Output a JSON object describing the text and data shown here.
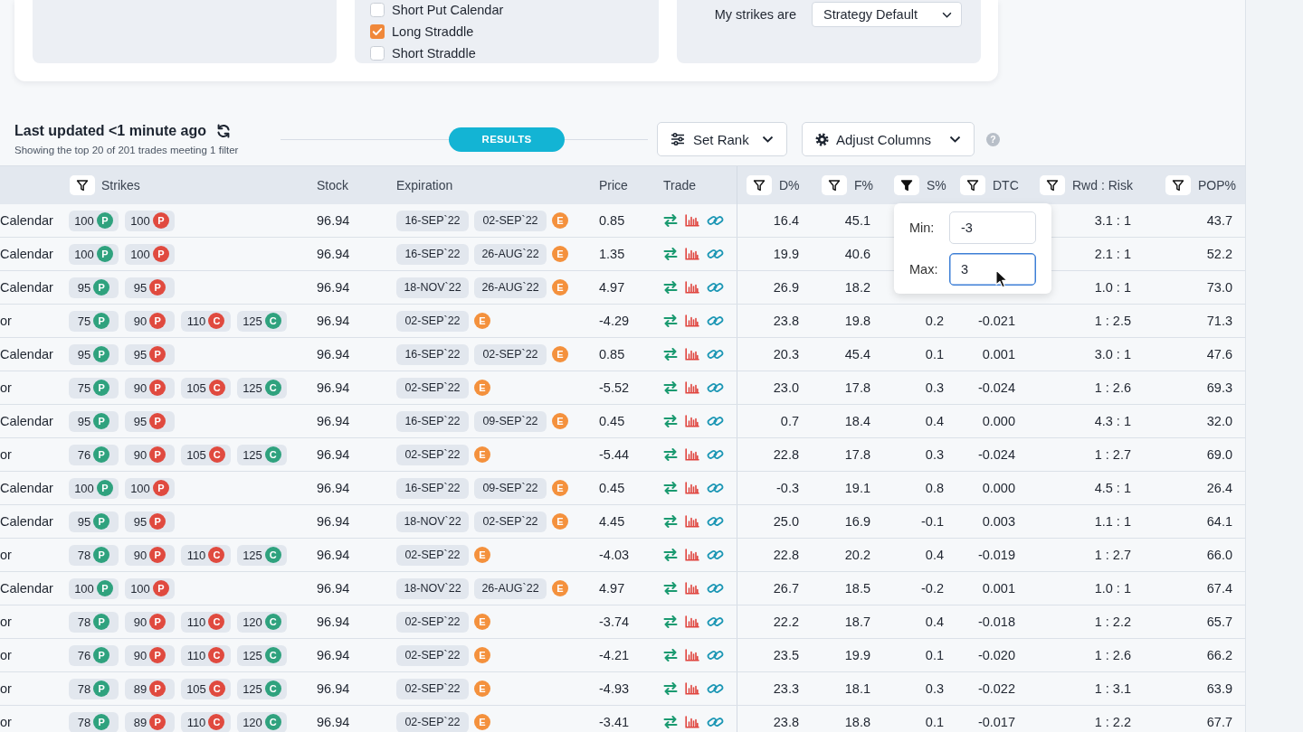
{
  "strategy_panel": {
    "checkboxes": [
      {
        "label": "Short Put Calendar",
        "checked": false
      },
      {
        "label": "Long Straddle",
        "checked": true
      },
      {
        "label": "Short Straddle",
        "checked": false
      }
    ]
  },
  "strikes_panel": {
    "label": "My strikes are",
    "select": {
      "value": "Strategy Default"
    }
  },
  "results_header": {
    "title": "Last updated <1 minute ago",
    "subtitle": "Showing the top 20 of 201 trades meeting 1 filter",
    "section_label": "RESULTS",
    "buttons": [
      {
        "label": "Set Rank",
        "kind": "rank"
      },
      {
        "label": "Adjust Columns",
        "kind": "columns"
      }
    ],
    "help": "?"
  },
  "table": {
    "columns": [
      {
        "label": "Strikes",
        "filter_active": false
      },
      {
        "label": "Stock"
      },
      {
        "label": "Expiration"
      },
      {
        "label": "Price"
      },
      {
        "label": "Trade"
      },
      {
        "label": "D%",
        "filter_active": false
      },
      {
        "label": "F%",
        "filter_active": false
      },
      {
        "label": "S%",
        "filter_active": true,
        "popup": {
          "fields": [
            {
              "label": "Min:",
              "value": "-3",
              "focused": false
            },
            {
              "label": "Max:",
              "value": "3",
              "focused": true
            }
          ]
        }
      },
      {
        "label": "DTC",
        "filter_active": false
      },
      {
        "label": "Rwd : Risk",
        "filter_active": false
      },
      {
        "label": "POP%",
        "filter_active": false
      }
    ],
    "rows": [
      {
        "column_1": "Calendar",
        "strikes": [
          {
            "value": "100",
            "type": "P",
            "color": "#2fa27e"
          },
          {
            "value": "100",
            "type": "P",
            "color": "#e04a3f"
          }
        ],
        "stock": "96.94",
        "expiration": {
          "dates": [
            "16-SEP`22",
            "02-SEP`22"
          ],
          "badge": "E"
        },
        "price": "0.85",
        "d_pct": "16.4",
        "f_pct": "45.1",
        "rwd_risk": "3.1 : 1",
        "pop_pct": "43.7"
      },
      {
        "column_1": "Calendar",
        "strikes": [
          {
            "value": "100",
            "type": "P",
            "color": "#2fa27e"
          },
          {
            "value": "100",
            "type": "P",
            "color": "#e04a3f"
          }
        ],
        "stock": "96.94",
        "expiration": {
          "dates": [
            "16-SEP`22",
            "26-AUG`22"
          ],
          "badge": "E"
        },
        "price": "1.35",
        "d_pct": "19.9",
        "f_pct": "40.6",
        "rwd_risk": "2.1 : 1",
        "pop_pct": "52.2"
      },
      {
        "column_1": "Calendar",
        "strikes": [
          {
            "value": "95",
            "type": "P",
            "color": "#2fa27e"
          },
          {
            "value": "95",
            "type": "P",
            "color": "#e04a3f"
          }
        ],
        "stock": "96.94",
        "expiration": {
          "dates": [
            "18-NOV`22",
            "26-AUG`22"
          ],
          "badge": "E"
        },
        "price": "4.97",
        "d_pct": "26.9",
        "f_pct": "18.2",
        "rwd_risk": "1.0 : 1",
        "pop_pct": "73.0"
      },
      {
        "column_1": "or",
        "strikes": [
          {
            "value": "75",
            "type": "P",
            "color": "#2fa27e"
          },
          {
            "value": "90",
            "type": "P",
            "color": "#e04a3f"
          },
          {
            "value": "110",
            "type": "C",
            "color": "#e04a3f"
          },
          {
            "value": "125",
            "type": "C",
            "color": "#2fa27e"
          }
        ],
        "stock": "96.94",
        "expiration": {
          "dates": [
            "02-SEP`22"
          ],
          "badge": "E"
        },
        "price": "-4.29",
        "d_pct": "23.8",
        "f_pct": "19.8",
        "s_pct": "0.2",
        "dtc": "-0.021",
        "rwd_risk": "1 : 2.5",
        "pop_pct": "71.3"
      },
      {
        "column_1": "Calendar",
        "strikes": [
          {
            "value": "95",
            "type": "P",
            "color": "#2fa27e"
          },
          {
            "value": "95",
            "type": "P",
            "color": "#e04a3f"
          }
        ],
        "stock": "96.94",
        "expiration": {
          "dates": [
            "16-SEP`22",
            "02-SEP`22"
          ],
          "badge": "E"
        },
        "price": "0.85",
        "d_pct": "20.3",
        "f_pct": "45.4",
        "s_pct": "0.1",
        "dtc": "0.001",
        "rwd_risk": "3.0 : 1",
        "pop_pct": "47.6"
      },
      {
        "column_1": "or",
        "strikes": [
          {
            "value": "75",
            "type": "P",
            "color": "#2fa27e"
          },
          {
            "value": "90",
            "type": "P",
            "color": "#e04a3f"
          },
          {
            "value": "105",
            "type": "C",
            "color": "#e04a3f"
          },
          {
            "value": "125",
            "type": "C",
            "color": "#2fa27e"
          }
        ],
        "stock": "96.94",
        "expiration": {
          "dates": [
            "02-SEP`22"
          ],
          "badge": "E"
        },
        "price": "-5.52",
        "d_pct": "23.0",
        "f_pct": "17.8",
        "s_pct": "0.3",
        "dtc": "-0.024",
        "rwd_risk": "1 : 2.6",
        "pop_pct": "69.3"
      },
      {
        "column_1": "Calendar",
        "strikes": [
          {
            "value": "95",
            "type": "P",
            "color": "#2fa27e"
          },
          {
            "value": "95",
            "type": "P",
            "color": "#e04a3f"
          }
        ],
        "stock": "96.94",
        "expiration": {
          "dates": [
            "16-SEP`22",
            "09-SEP`22"
          ],
          "badge": "E"
        },
        "price": "0.45",
        "d_pct": "0.7",
        "f_pct": "18.4",
        "s_pct": "0.4",
        "dtc": "0.000",
        "rwd_risk": "4.3 : 1",
        "pop_pct": "32.0"
      },
      {
        "column_1": "or",
        "strikes": [
          {
            "value": "76",
            "type": "P",
            "color": "#2fa27e"
          },
          {
            "value": "90",
            "type": "P",
            "color": "#e04a3f"
          },
          {
            "value": "105",
            "type": "C",
            "color": "#e04a3f"
          },
          {
            "value": "125",
            "type": "C",
            "color": "#2fa27e"
          }
        ],
        "stock": "96.94",
        "expiration": {
          "dates": [
            "02-SEP`22"
          ],
          "badge": "E"
        },
        "price": "-5.44",
        "d_pct": "22.8",
        "f_pct": "17.8",
        "s_pct": "0.3",
        "dtc": "-0.024",
        "rwd_risk": "1 : 2.7",
        "pop_pct": "69.0"
      },
      {
        "column_1": "Calendar",
        "strikes": [
          {
            "value": "100",
            "type": "P",
            "color": "#2fa27e"
          },
          {
            "value": "100",
            "type": "P",
            "color": "#e04a3f"
          }
        ],
        "stock": "96.94",
        "expiration": {
          "dates": [
            "16-SEP`22",
            "09-SEP`22"
          ],
          "badge": "E"
        },
        "price": "0.45",
        "d_pct": "-0.3",
        "f_pct": "19.1",
        "s_pct": "0.8",
        "dtc": "0.000",
        "rwd_risk": "4.5 : 1",
        "pop_pct": "26.4"
      },
      {
        "column_1": "Calendar",
        "strikes": [
          {
            "value": "95",
            "type": "P",
            "color": "#2fa27e"
          },
          {
            "value": "95",
            "type": "P",
            "color": "#e04a3f"
          }
        ],
        "stock": "96.94",
        "expiration": {
          "dates": [
            "18-NOV`22",
            "02-SEP`22"
          ],
          "badge": "E"
        },
        "price": "4.45",
        "d_pct": "25.0",
        "f_pct": "16.9",
        "s_pct": "-0.1",
        "dtc": "0.003",
        "rwd_risk": "1.1 : 1",
        "pop_pct": "64.1"
      },
      {
        "column_1": "or",
        "strikes": [
          {
            "value": "78",
            "type": "P",
            "color": "#2fa27e"
          },
          {
            "value": "90",
            "type": "P",
            "color": "#e04a3f"
          },
          {
            "value": "110",
            "type": "C",
            "color": "#e04a3f"
          },
          {
            "value": "125",
            "type": "C",
            "color": "#2fa27e"
          }
        ],
        "stock": "96.94",
        "expiration": {
          "dates": [
            "02-SEP`22"
          ],
          "badge": "E"
        },
        "price": "-4.03",
        "d_pct": "22.8",
        "f_pct": "20.2",
        "s_pct": "0.4",
        "dtc": "-0.019",
        "rwd_risk": "1 : 2.7",
        "pop_pct": "66.0"
      },
      {
        "column_1": "Calendar",
        "strikes": [
          {
            "value": "100",
            "type": "P",
            "color": "#2fa27e"
          },
          {
            "value": "100",
            "type": "P",
            "color": "#e04a3f"
          }
        ],
        "stock": "96.94",
        "expiration": {
          "dates": [
            "18-NOV`22",
            "26-AUG`22"
          ],
          "badge": "E"
        },
        "price": "4.97",
        "d_pct": "26.7",
        "f_pct": "18.5",
        "s_pct": "-0.2",
        "dtc": "0.001",
        "rwd_risk": "1.0 : 1",
        "pop_pct": "67.4"
      },
      {
        "column_1": "or",
        "strikes": [
          {
            "value": "78",
            "type": "P",
            "color": "#2fa27e"
          },
          {
            "value": "90",
            "type": "P",
            "color": "#e04a3f"
          },
          {
            "value": "110",
            "type": "C",
            "color": "#e04a3f"
          },
          {
            "value": "120",
            "type": "C",
            "color": "#2fa27e"
          }
        ],
        "stock": "96.94",
        "expiration": {
          "dates": [
            "02-SEP`22"
          ],
          "badge": "E"
        },
        "price": "-3.74",
        "d_pct": "22.2",
        "f_pct": "18.7",
        "s_pct": "0.4",
        "dtc": "-0.018",
        "rwd_risk": "1 : 2.2",
        "pop_pct": "65.7"
      },
      {
        "column_1": "or",
        "strikes": [
          {
            "value": "76",
            "type": "P",
            "color": "#2fa27e"
          },
          {
            "value": "90",
            "type": "P",
            "color": "#e04a3f"
          },
          {
            "value": "110",
            "type": "C",
            "color": "#e04a3f"
          },
          {
            "value": "125",
            "type": "C",
            "color": "#2fa27e"
          }
        ],
        "stock": "96.94",
        "expiration": {
          "dates": [
            "02-SEP`22"
          ],
          "badge": "E"
        },
        "price": "-4.21",
        "d_pct": "23.5",
        "f_pct": "19.9",
        "s_pct": "0.1",
        "dtc": "-0.020",
        "rwd_risk": "1 : 2.6",
        "pop_pct": "66.2"
      },
      {
        "column_1": "or",
        "strikes": [
          {
            "value": "78",
            "type": "P",
            "color": "#2fa27e"
          },
          {
            "value": "89",
            "type": "P",
            "color": "#e04a3f"
          },
          {
            "value": "105",
            "type": "C",
            "color": "#e04a3f"
          },
          {
            "value": "125",
            "type": "C",
            "color": "#2fa27e"
          }
        ],
        "stock": "96.94",
        "expiration": {
          "dates": [
            "02-SEP`22"
          ],
          "badge": "E"
        },
        "price": "-4.93",
        "d_pct": "23.3",
        "f_pct": "18.1",
        "s_pct": "0.3",
        "dtc": "-0.022",
        "rwd_risk": "1 : 3.1",
        "pop_pct": "63.9"
      },
      {
        "column_1": "or",
        "strikes": [
          {
            "value": "78",
            "type": "P",
            "color": "#2fa27e"
          },
          {
            "value": "89",
            "type": "P",
            "color": "#e04a3f"
          },
          {
            "value": "110",
            "type": "C",
            "color": "#e04a3f"
          },
          {
            "value": "120",
            "type": "C",
            "color": "#2fa27e"
          }
        ],
        "stock": "96.94",
        "expiration": {
          "dates": [
            "02-SEP`22"
          ],
          "badge": "E"
        },
        "price": "-3.41",
        "d_pct": "23.8",
        "f_pct": "18.8",
        "s_pct": "0.1",
        "dtc": "-0.017",
        "rwd_risk": "1 : 2.2",
        "pop_pct": "67.7"
      }
    ]
  }
}
